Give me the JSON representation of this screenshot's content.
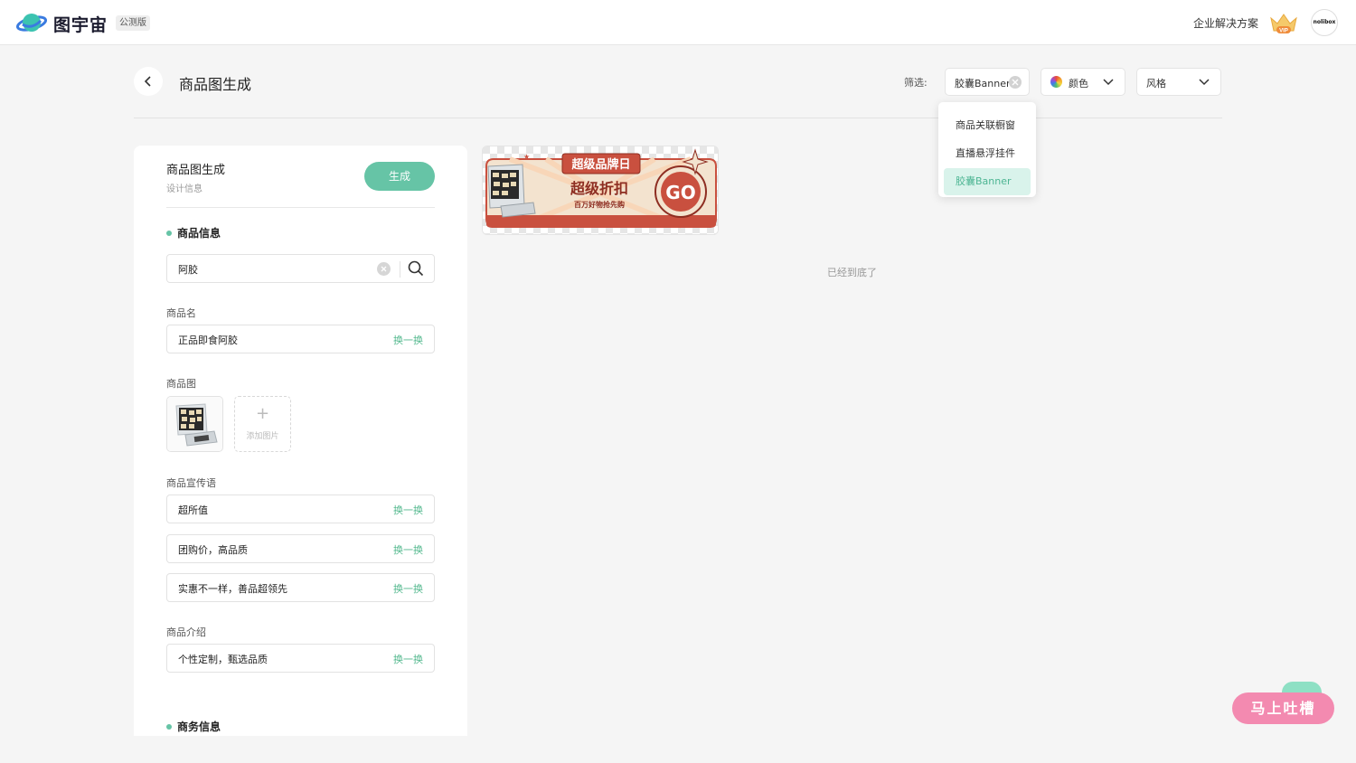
{
  "app": {
    "brand": "图宇宙",
    "beta": "公测版",
    "enterprise": "企业解决方案",
    "vip_label": "VIP",
    "avatar_text": "nolibox"
  },
  "header": {
    "title": "商品图生成"
  },
  "filters": {
    "label": "筛选:",
    "type_value": "胶囊Banner",
    "color_label": "颜色",
    "style_label": "风格",
    "dropdown_options": [
      "商品关联橱窗",
      "直播悬浮挂件",
      "胶囊Banner"
    ],
    "selected_option": "胶囊Banner"
  },
  "panel": {
    "title": "商品图生成",
    "subtitle": "设计信息",
    "generate": "生成",
    "section_product": "商品信息",
    "search_value": "阿胶",
    "name_label": "商品名",
    "name_value": "正品即食阿胶",
    "image_label": "商品图",
    "add_image": "添加图片",
    "slogan_label": "商品宣传语",
    "slogans": [
      "超所值",
      "团购价，高品质",
      "实惠不一样，善品超领先"
    ],
    "intro_label": "商品介绍",
    "intro_value": "个性定制，甄选品质",
    "swap": "换一换",
    "section_business": "商务信息"
  },
  "banner": {
    "tag": "超级品牌日",
    "headline": "超级折扣",
    "sub": "百万好物抢先购",
    "go": "GO"
  },
  "results": {
    "end_message": "已经到底了"
  },
  "feedback": {
    "label": "马上吐槽"
  },
  "colors": {
    "accent": "#66c4a6",
    "swap_text": "#55b98f",
    "feedback": "#f38ab0",
    "banner_red": "#c9503f"
  }
}
